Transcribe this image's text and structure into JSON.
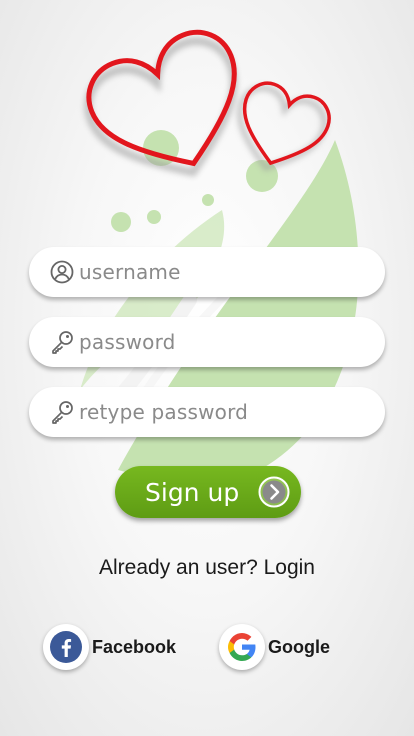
{
  "form": {
    "username_placeholder": "username",
    "password_placeholder": "password",
    "retype_placeholder": "retype password"
  },
  "signup": {
    "label": "Sign up"
  },
  "login": {
    "prompt": "Already an user? Login"
  },
  "social": {
    "facebook_label": "Facebook",
    "google_label": "Google"
  },
  "colors": {
    "accent_green": "#6aab18",
    "leaf_green": "#c5e2b0",
    "heart_red": "#e2161d",
    "facebook_blue": "#3b5998"
  },
  "icons": [
    "user-circle-icon",
    "key-icon",
    "chevron-right-icon",
    "facebook-icon",
    "google-icon",
    "heart-icon",
    "leaf-icon"
  ]
}
